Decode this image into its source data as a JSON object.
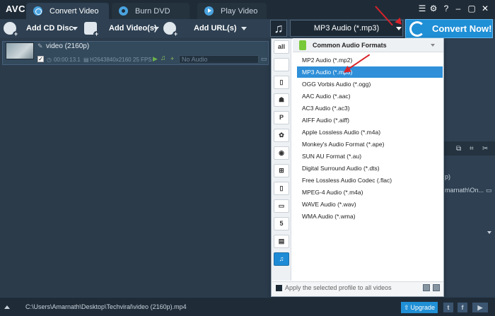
{
  "app": {
    "logo": "AVC"
  },
  "tabs": [
    {
      "label": "Convert Video"
    },
    {
      "label": "Burn DVD"
    },
    {
      "label": "Play Video"
    }
  ],
  "toolbar": {
    "add_cd_label": "Add CD Disc",
    "add_video_label": "Add Video(s)",
    "add_url_label": "Add URL(s)"
  },
  "profile": {
    "selected": "MP3 Audio (*.mp3)",
    "convert_label": "Convert Now!"
  },
  "file": {
    "name": "video (2160p)",
    "duration": "00:00:13.1",
    "codec": "H264",
    "resolution": "3840x2160",
    "fps": "25 FPS",
    "audio_placeholder": "No Audio"
  },
  "dropdown": {
    "category_title": "Common Audio Formats",
    "categories": [
      "all",
      "apple",
      "tablet",
      "android",
      "playstation",
      "huawei",
      "xbox",
      "windows",
      "phone",
      "tv",
      "html5",
      "video",
      "audio"
    ],
    "formats": [
      "MP2 Audio (*.mp2)",
      "MP3 Audio (*.mp3)",
      "OGG Vorbis Audio (*.ogg)",
      "AAC Audio (*.aac)",
      "AC3 Audio (*.ac3)",
      "AIFF Audio (*.aiff)",
      "Apple Lossless Audio (*.m4a)",
      "Monkey's Audio Format (*.ape)",
      "SUN AU Format (*.au)",
      "Digital Surround Audio (*.dts)",
      "Free Lossless Audio Codec (.flac)",
      "MPEG-4 Audio (*.m4a)",
      "WAVE Audio (*.wav)",
      "WMA Audio (*.wma)"
    ],
    "selected_index": 1,
    "apply_label": "Apply the selected profile to all videos"
  },
  "right_panel": {
    "line1": "p)",
    "line2": "marnath\\On..."
  },
  "status": {
    "path": "C:\\Users\\Amarnath\\Desktop\\Techviral\\video (2160p).mp4",
    "upgrade_label": "Upgrade"
  },
  "colors": {
    "accent": "#1f8fd6",
    "selection": "#2f8fd8",
    "annotation": "#d9232a"
  }
}
